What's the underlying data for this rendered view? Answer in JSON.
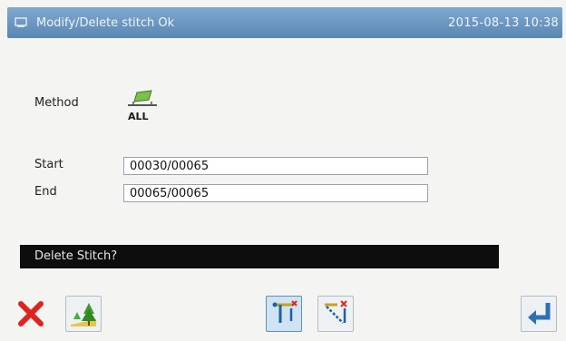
{
  "header": {
    "title": "Modify/Delete stitch  Ok",
    "datetime": "2015-08-13 10:38"
  },
  "form": {
    "method_label": "Method",
    "method_icon": "sewing-all-icon",
    "method_icon_text": "ALL",
    "start_label": "Start",
    "start_value": "00030/00065",
    "end_label": "End",
    "end_value": "00065/00065"
  },
  "message": "Delete Stitch?",
  "toolbar": {
    "cancel_icon": "red-x-icon",
    "tree_icon": "tree-scene-icon",
    "stitch_mode1_icon": "stitch-path-icon",
    "stitch_mode2_icon": "stitch-path-alt-icon",
    "enter_icon": "enter-arrow-icon"
  },
  "colors": {
    "titlebar": "#6a97c1",
    "message_bar": "#0d0d0d",
    "cancel_red": "#e0231b",
    "enter_blue": "#2f6fb8"
  }
}
